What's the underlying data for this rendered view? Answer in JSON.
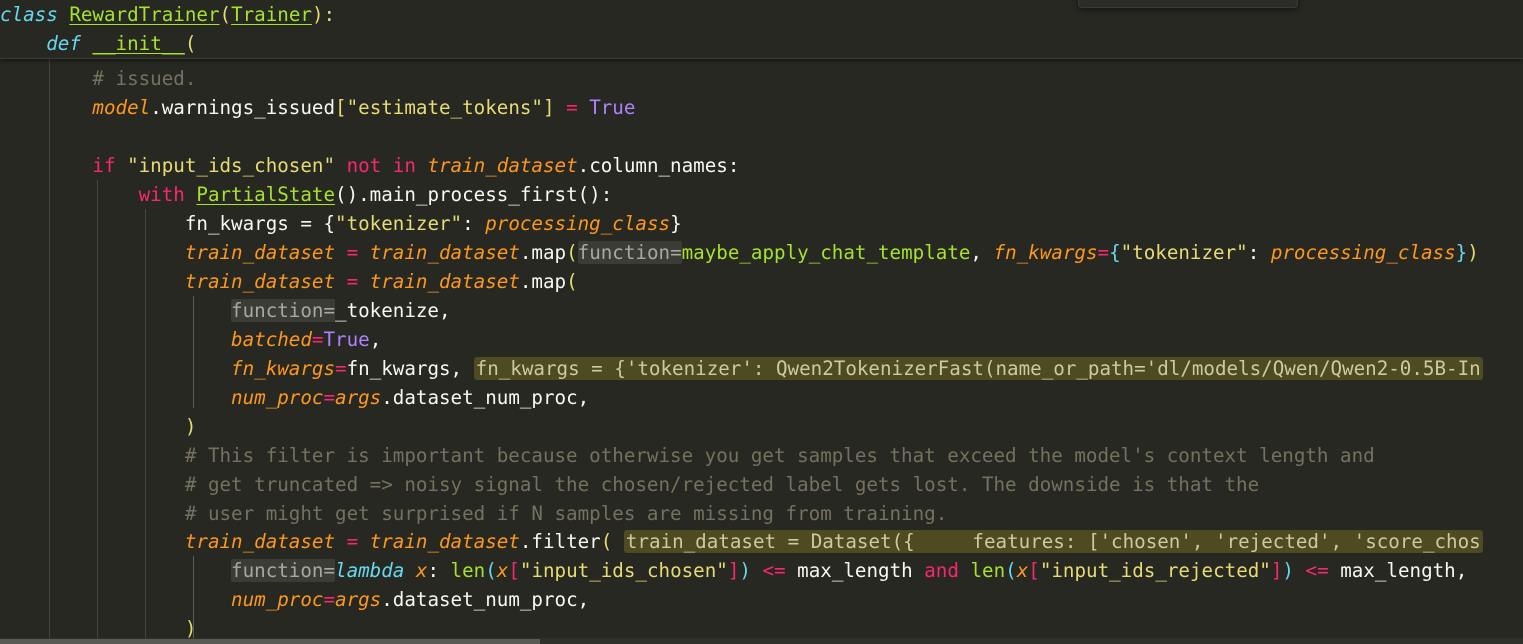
{
  "sticky": {
    "class_kw": "class",
    "class_name": "RewardTrainer",
    "paren_open": "(",
    "base_class": "Trainer",
    "paren_close_colon": "):",
    "def_kw": "def",
    "init_name": "__init__",
    "init_paren": "("
  },
  "code": {
    "l1_comment": "# issued.",
    "l2_model": "model",
    "l2_attr": ".warnings_issued",
    "l2_lb": "[",
    "l2_str": "\"estimate_tokens\"",
    "l2_rb": "]",
    "l2_eq": " = ",
    "l2_true": "True",
    "l4_if": "if",
    "l4_str": " \"input_ids_chosen\" ",
    "l4_notin": "not in",
    "l4_sp": " ",
    "l4_td": "train_dataset",
    "l4_rest": ".column_names:",
    "l5_with": "with",
    "l5_ps": "PartialState",
    "l5_rest": "().main_process_first():",
    "l6_a": "fn_kwargs = {",
    "l6_str": "\"tokenizer\"",
    "l6_colon": ": ",
    "l6_pc": "processing_class",
    "l6_rb": "}",
    "l7_td": "train_dataset",
    "l7_eq": " = ",
    "l7_td2": "train_dataset",
    "l7_map": ".map",
    "l7_lp": "(",
    "l7_fnh": "function=",
    "l7_func": "maybe_apply_chat_template",
    "l7_comma": ", ",
    "l7_fk": "fn_kwargs",
    "l7_eq2": "=",
    "l7_lb": "{",
    "l7_str": "\"tokenizer\"",
    "l7_colon": ": ",
    "l7_pc": "processing_class",
    "l7_rb": "}",
    "l7_rp": ")",
    "l8_td": "train_dataset",
    "l8_eq": " = ",
    "l8_td2": "train_dataset",
    "l8_map": ".map",
    "l8_lp": "(",
    "l9_fnh": "function=",
    "l9_val": "_tokenize,",
    "l10_b": "batched",
    "l10_eq": "=",
    "l10_true": "True",
    "l10_comma": ",",
    "l11_fk": "fn_kwargs",
    "l11_eq": "=",
    "l11_val": "fn_kwargs, ",
    "l11_inlay": "fn_kwargs = {'tokenizer': Qwen2TokenizerFast(name_or_path='dl/models/Qwen/Qwen2-0.5B-In",
    "l12_np": "num_proc",
    "l12_eq": "=",
    "l12_args": "args",
    "l12_rest": ".dataset_num_proc,",
    "l13_rp": ")",
    "l14_c": "# This filter is important because otherwise you get samples that exceed the model's context length and",
    "l15_c": "# get truncated => noisy signal the chosen/rejected label gets lost. The downside is that the",
    "l16_c": "# user might get surprised if N samples are missing from training.",
    "l17_td": "train_dataset",
    "l17_eq": " = ",
    "l17_td2": "train_dataset",
    "l17_filter": ".filter",
    "l17_lp": "(",
    "l17_sp": " ",
    "l17_inlay": "train_dataset = Dataset({     features: ['chosen', 'rejected', 'score_chos",
    "l18_fnh": "function=",
    "l18_lambda": "lambda",
    "l18_x": " x",
    "l18_colon": ": ",
    "l18_len": "len",
    "l18_lp": "(",
    "l18_x2": "x",
    "l18_lb": "[",
    "l18_str": "\"input_ids_chosen\"",
    "l18_rb": "]",
    "l18_rp": ")",
    "l18_le": " <= ",
    "l18_ml": "max_length ",
    "l18_and": "and",
    "l18_sp": " ",
    "l18_len2": "len",
    "l18_lp2": "(",
    "l18_x3": "x",
    "l18_lb2": "[",
    "l18_str2": "\"input_ids_rejected\"",
    "l18_rb2": "]",
    "l18_rp2": ")",
    "l18_le2": " <= ",
    "l18_ml2": "max_length,",
    "l19_np": "num_proc",
    "l19_eq": "=",
    "l19_args": "args",
    "l19_rest": ".dataset_num_proc,",
    "l20_rp": ")"
  },
  "colors": {
    "background": "#272822",
    "keyword": "#f92672",
    "storage": "#66d9ef",
    "function": "#a6e22e",
    "string": "#e6db74",
    "constant": "#ae81ff",
    "parameter": "#fd971f",
    "comment": "#75715e"
  }
}
